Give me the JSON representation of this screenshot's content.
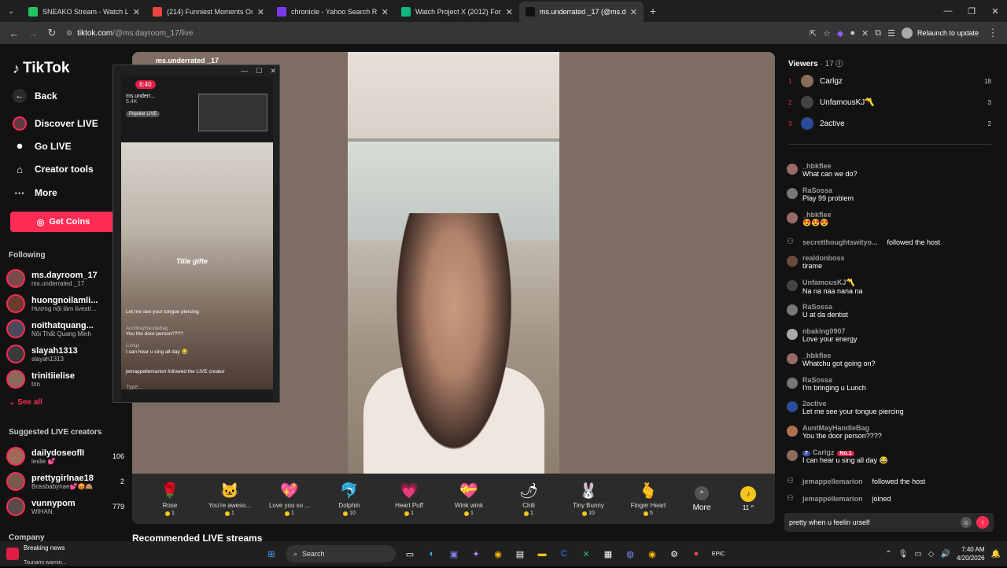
{
  "browser": {
    "tabs": [
      {
        "title": "SNEAKO Stream - Watch Live o",
        "color": "#22c55e"
      },
      {
        "title": "(214) Funniest Moments On Po",
        "color": "#ef4444"
      },
      {
        "title": "chronicle - Yahoo Search Result",
        "color": "#7c3aed"
      },
      {
        "title": "Watch Project X (2012) For Free",
        "color": "#10b981"
      },
      {
        "title": "ms.underrated _17 (@ms.d",
        "color": "#111111"
      }
    ],
    "url_host": "tiktok.com",
    "url_path": "/@ms.dayroom_17/live",
    "relaunch": "Relaunch to update"
  },
  "sidebar": {
    "brand": "TikTok",
    "back": "Back",
    "nav": [
      "Discover LIVE",
      "Go LIVE",
      "Creator tools",
      "More"
    ],
    "get_coins": "Get Coins",
    "following_label": "Following",
    "following": [
      {
        "name": "ms.dayroom_17",
        "sub": "ms.underrated _17"
      },
      {
        "name": "huongnoilamli...",
        "sub": "Hương nội làm livestr..."
      },
      {
        "name": "noithatquang...",
        "sub": "Nội Thất Quang Minh"
      },
      {
        "name": "slayah1313",
        "sub": "slayah1313"
      },
      {
        "name": "trinitiielise",
        "sub": "trin"
      }
    ],
    "see_all": "See all",
    "suggested_label": "Suggested LIVE creators",
    "suggested": [
      {
        "name": "dailydoseoflI",
        "sub": "leslie 💕",
        "count": "106"
      },
      {
        "name": "prettygirlnae18",
        "sub": "Bossbabynae💕😡🙈",
        "count": "2"
      },
      {
        "name": "vunnypom",
        "sub": "WIHAN.",
        "count": "779"
      }
    ],
    "company": "Company"
  },
  "stage": {
    "host": "ms.underrated _17",
    "recommended": "Recommended LIVE streams"
  },
  "mini": {
    "time": "6:40",
    "host": "ms.underr...",
    "followers": "5.4K",
    "popular": "Popular LIVE",
    "title_gift": "Title gifte",
    "chat": [
      {
        "u": "",
        "t": "Let me see your tongue piercing"
      },
      {
        "u": "AuntMayHandleBag",
        "t": "You the door person????"
      },
      {
        "u": "Carlgz",
        "t": "I can hear u sing all day 😂"
      },
      {
        "u": "",
        "t": "jemappellemarion followed the LIVE creator"
      }
    ],
    "type": "Type..."
  },
  "gifts": [
    {
      "icon": "🌹",
      "name": "Rose",
      "price": "1"
    },
    {
      "icon": "🐱",
      "name": "You're aweso...",
      "price": "1"
    },
    {
      "icon": "💖",
      "name": "Love you so ...",
      "price": "1"
    },
    {
      "icon": "🐬",
      "name": "Dolphin",
      "price": "10"
    },
    {
      "icon": "💗",
      "name": "Heart Puff",
      "price": "1"
    },
    {
      "icon": "💝",
      "name": "Wink wink",
      "price": "1"
    },
    {
      "icon": "🌶",
      "name": "Chili",
      "price": "1"
    },
    {
      "icon": "🐰",
      "name": "Tiny Bunny",
      "price": "10"
    },
    {
      "icon": "🫰",
      "name": "Finger Heart",
      "price": "5"
    }
  ],
  "gift_more": "More",
  "coin_count": "11",
  "panel": {
    "viewers_label": "Viewers",
    "viewers_count": "· 17",
    "top": [
      {
        "rank": "1",
        "name": "Carlgz",
        "score": "18",
        "color": "#8a6d5a"
      },
      {
        "rank": "2",
        "name": "UnfamousKJ〽️",
        "score": "3",
        "color": "#444"
      },
      {
        "rank": "3",
        "name": "2active",
        "score": "2",
        "color": "#2b4c9a"
      }
    ],
    "messages": [
      {
        "u": "_hbkflee",
        "t": "What can we do?",
        "color": "#9a6a6a"
      },
      {
        "u": "RaSossa",
        "t": "Play 99 problem",
        "color": "#777"
      },
      {
        "u": "_hbkflee",
        "t": "😍😍😍",
        "color": "#9a6a6a"
      },
      {
        "u": "realdonboss",
        "t": "tirame",
        "color": "#6a4a3a"
      },
      {
        "u": "UnfamousKJ〽️",
        "t": "Na na naa nana na",
        "color": "#444"
      },
      {
        "u": "RaSossa",
        "t": "U at da dentist",
        "color": "#777"
      },
      {
        "u": "nbaking0907",
        "t": "Love your energy",
        "color": "#aaa"
      },
      {
        "u": "_hbkflee",
        "t": "Whatchu got going on?",
        "color": "#9a6a6a"
      },
      {
        "u": "RaSossa",
        "t": "I'm bringing u Lunch",
        "color": "#777"
      },
      {
        "u": "2active",
        "t": "Let me see your tongue piercing",
        "color": "#2b4c9a"
      },
      {
        "u": "AuntMayHandleBag",
        "t": "You the door person????",
        "color": "#b07050"
      },
      {
        "u": "Carlgz",
        "t": "I can hear u sing all day 😂",
        "color": "#8a6d5a",
        "badge1": "7",
        "badge2": "No.1"
      }
    ],
    "system": [
      {
        "u": "secretthoughtswityo...",
        "t": "followed the host"
      },
      {
        "u": "jemappellemarion",
        "t": "followed the host"
      },
      {
        "u": "jemappellemarion",
        "t": "joined"
      }
    ],
    "input_value": "pretty when u feelin urself"
  },
  "taskbar": {
    "news_title": "Breaking news",
    "news_sub": "Tsunami warnin...",
    "search": "Search",
    "time": "7:40 AM",
    "date": "4/20/2026"
  }
}
